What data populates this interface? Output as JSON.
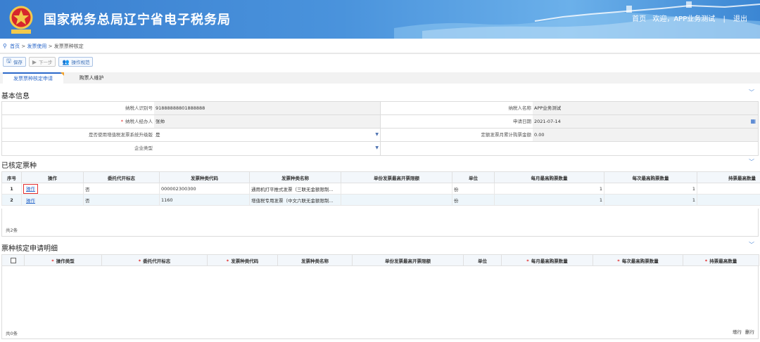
{
  "header": {
    "title": "国家税务总局辽宁省电子税务局",
    "links": [
      "首页",
      "欢迎，APP业务测试",
      "退出"
    ],
    "separator": "|"
  },
  "breadcrumb": {
    "items": [
      "首页",
      "发票使用",
      "发票票种核定"
    ],
    "separator": ">"
  },
  "toolbar": {
    "save": "保存",
    "next": "下一步",
    "guide": "操作规范"
  },
  "tabs": [
    "发票票种核定申请",
    "购票人维护"
  ],
  "basic_info": {
    "title": "基本信息",
    "taxpayer_id_label": "纳税人识别号",
    "taxpayer_id": "91888888801888888",
    "taxpayer_name_label": "纳税人名称",
    "taxpayer_name": "APP业务测试",
    "handler_label": "纳税人经办人",
    "handler": "张帅",
    "apply_date_label": "申请日期",
    "apply_date": "2021-07-14",
    "upgrade_label": "是否使用增值税发票系统升级版",
    "upgrade": "是",
    "monthly_amount_label": "定额发票月累计购票金额",
    "monthly_amount": "0.00",
    "enterprise_type_label": "企业类型",
    "enterprise_type": "",
    "req_mark": "*"
  },
  "approved": {
    "title": "已核定票种",
    "columns": [
      "序号",
      "操作",
      "委托代开标志",
      "发票种类代码",
      "发票种类名称",
      "单份发票最高开票限额",
      "单位",
      "每月最高购票数量",
      "每次最高购票数量",
      "持票最高数量"
    ],
    "rows": [
      {
        "no": "1",
        "op": "操作",
        "entrust": "否",
        "code": "000002300300",
        "name": "通用机打平推式发票（三联无金额限制...",
        "limit": "",
        "unit": "份",
        "monthly": "1",
        "each": "1",
        "hold": "1"
      },
      {
        "no": "2",
        "op": "操作",
        "entrust": "否",
        "code": "1160",
        "name": "增值税专用发票（中文六联无金额限制...",
        "limit": "",
        "unit": "份",
        "monthly": "1",
        "each": "1",
        "hold": "1"
      }
    ],
    "count": "共2条"
  },
  "detail": {
    "title": "票种核定申请明细",
    "columns": [
      "操作类型",
      "委托代开标志",
      "发票种类代码",
      "发票种类名称",
      "单份发票最高开票限额",
      "单位",
      "每月最高购票数量",
      "每次最高购票数量",
      "持票最高数量"
    ],
    "required_mark": "*",
    "count": "共0条",
    "add_row": "增行",
    "del_row": "删行"
  },
  "colors": {
    "accent": "#2a67c9",
    "header": "#4a93dc",
    "highlight": "#e53030"
  }
}
